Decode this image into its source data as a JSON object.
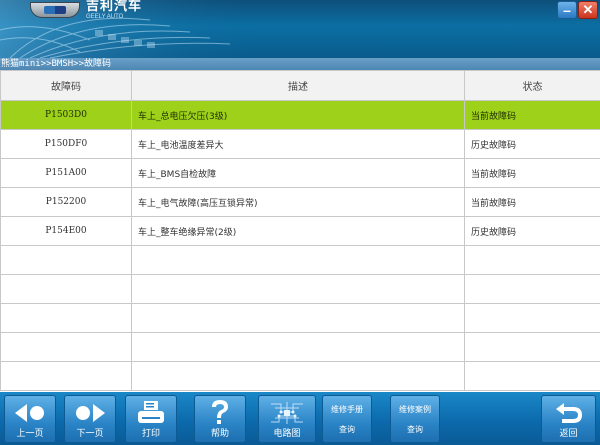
{
  "header": {
    "brand_cn": "吉利汽车",
    "brand_en": "GEELY AUTO",
    "minimize_glyph": "–",
    "close_glyph": "✕"
  },
  "breadcrumb": "熊猫mini>>BMSH>>故障码",
  "table": {
    "headers": [
      "故障码",
      "描述",
      "状态"
    ],
    "rows": [
      {
        "code": "P1503D0",
        "desc": "车上_总电压欠压(3级)",
        "status": "当前故障码",
        "selected": true
      },
      {
        "code": "P150DF0",
        "desc": "车上_电池温度差异大",
        "status": "历史故障码",
        "selected": false
      },
      {
        "code": "P151A00",
        "desc": "车上_BMS自检故障",
        "status": "当前故障码",
        "selected": false
      },
      {
        "code": "P152200",
        "desc": "车上_电气故障(高压互锁异常)",
        "status": "当前故障码",
        "selected": false
      },
      {
        "code": "P154E00",
        "desc": "车上_整车绝缘异常(2级)",
        "status": "历史故障码",
        "selected": false
      }
    ],
    "empty_rows": 5
  },
  "toolbar": {
    "prev_label": "上一页",
    "next_label": "下一页",
    "print_label": "打印",
    "help_label": "帮助",
    "circuit_label": "电路图",
    "manual_line1": "维修手册",
    "manual_line2": "查询",
    "case_line1": "维修案例",
    "case_line2": "查询",
    "back_label": "返回"
  },
  "colors": {
    "selected_row": "#9ed11a",
    "toolbar": "#0c6aac",
    "breadcrumb_bg": "#5a93bd"
  }
}
